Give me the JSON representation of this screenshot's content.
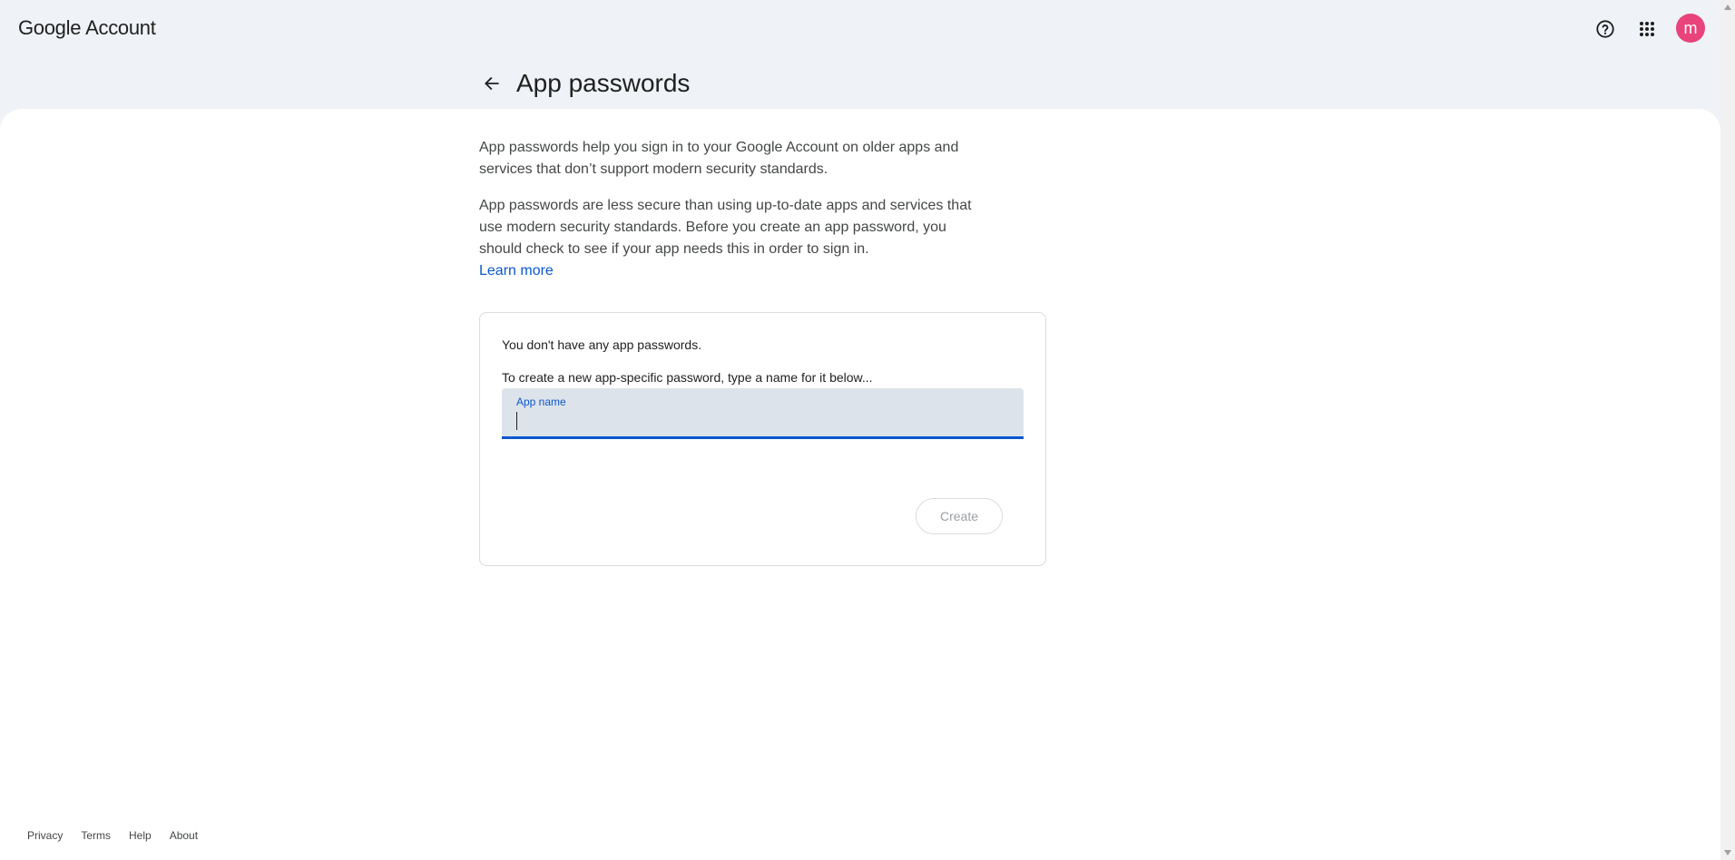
{
  "header": {
    "logo_brand": "Google",
    "logo_product": "Account",
    "avatar_letter": "m",
    "avatar_color": "#e8437a"
  },
  "page": {
    "title": "App passwords",
    "intro_p1": "App passwords help you sign in to your Google Account on older apps and services that don’t support modern security standards.",
    "intro_p2": "App passwords are less secure than using up-to-date apps and services that use modern security standards. Before you create an app password, you should check to see if your app needs this in order to sign in.",
    "learn_more": "Learn more"
  },
  "card": {
    "empty_message": "You don't have any app passwords.",
    "instruction": "To create a new app-specific password, type a name for it below...",
    "field_label": "App name",
    "field_value": "",
    "create_label": "Create"
  },
  "footer": {
    "links": [
      "Privacy",
      "Terms",
      "Help",
      "About"
    ]
  },
  "colors": {
    "accent": "#0b57d0",
    "background": "#eff2f7",
    "field_bg": "#dde3ea"
  },
  "icons": [
    "help-icon",
    "apps-grid-icon",
    "back-arrow-icon"
  ]
}
